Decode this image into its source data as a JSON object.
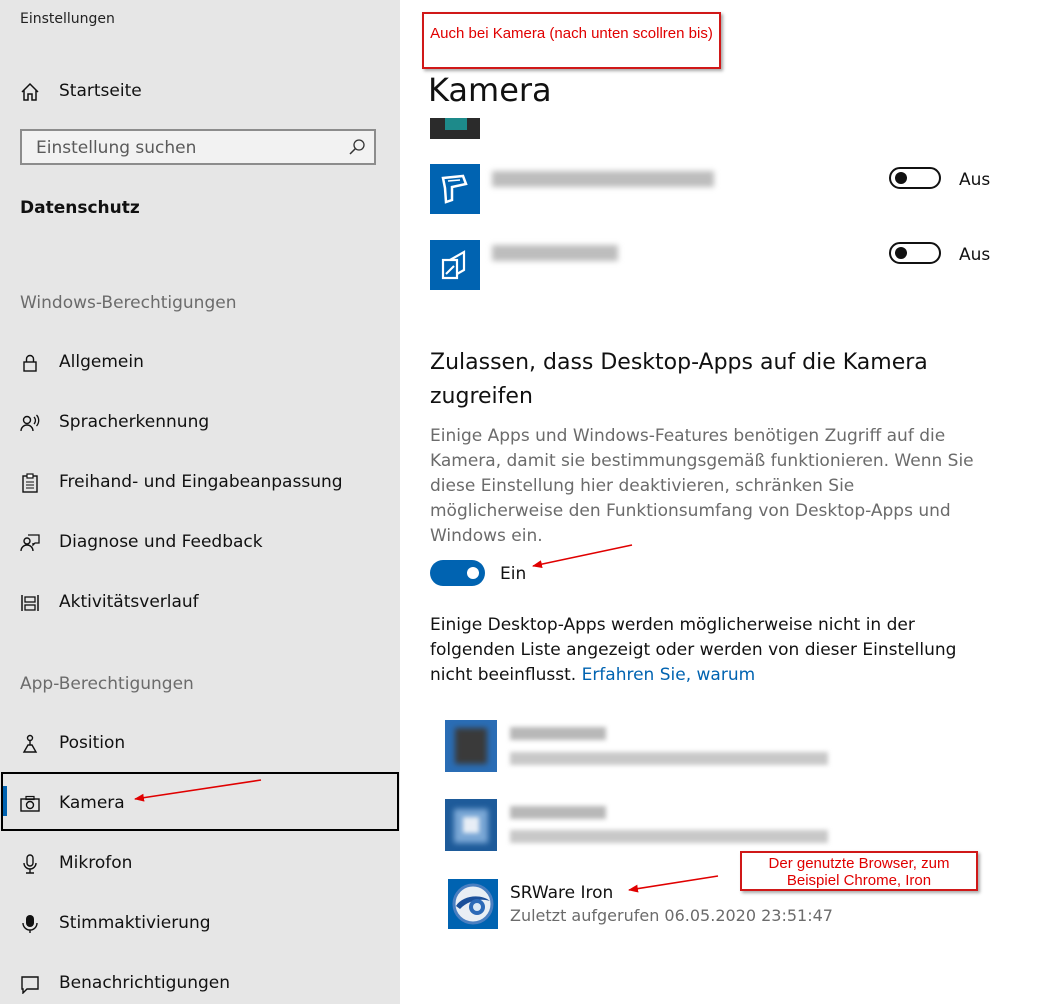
{
  "window": {
    "title": "Einstellungen"
  },
  "sidebar": {
    "home_label": "Startseite",
    "search_placeholder": "Einstellung suchen",
    "section_label": "Datenschutz",
    "group1_label": "Windows-Berechtigungen",
    "group1_items": [
      {
        "label": "Allgemein",
        "icon": "lock-icon"
      },
      {
        "label": "Spracherkennung",
        "icon": "speech-icon"
      },
      {
        "label": "Freihand- und Eingabeanpassung",
        "icon": "clipboard-icon"
      },
      {
        "label": "Diagnose und Feedback",
        "icon": "feedback-icon"
      },
      {
        "label": "Aktivitätsverlauf",
        "icon": "timeline-icon"
      }
    ],
    "group2_label": "App-Berechtigungen",
    "group2_items": [
      {
        "label": "Position",
        "icon": "position-icon"
      },
      {
        "label": "Kamera",
        "icon": "camera-icon",
        "selected": true
      },
      {
        "label": "Mikrofon",
        "icon": "microphone-icon"
      },
      {
        "label": "Stimmaktivierung",
        "icon": "voice-activation-icon"
      },
      {
        "label": "Benachrichtigungen",
        "icon": "notification-icon"
      }
    ]
  },
  "main": {
    "title": "Kamera",
    "store_apps": [
      {
        "toggle_label": "Aus",
        "state": "off"
      },
      {
        "toggle_label": "Aus",
        "state": "off"
      }
    ],
    "desktop_section": {
      "heading": "Zulassen, dass Desktop-Apps auf die Kamera zugreifen",
      "description": "Einige Apps und Windows-Features benötigen Zugriff auf die Kamera, damit sie bestimmungsgemäß funktionieren. Wenn Sie diese Einstellung hier deaktivieren, schränken Sie möglicherweise den Funktionsumfang von Desktop-Apps und Windows ein.",
      "toggle_label": "Ein",
      "note": "Einige Desktop-Apps werden möglicherweise nicht in der folgenden Liste angezeigt oder werden von dieser Einstellung nicht beeinflusst.",
      "link": "Erfahren Sie, warum"
    },
    "desktop_apps": [
      {
        "name": "SRWare Iron",
        "last_access": "Zuletzt aufgerufen 06.05.2020 23:51:47"
      }
    ]
  },
  "annotations": {
    "callout_top": "Auch bei Kamera (nach unten scollren bis)",
    "callout_browser": "Der genutzte Browser, zum Beispiel Chrome, Iron"
  },
  "colors": {
    "accent": "#0063b1",
    "callout_red": "#e00000",
    "sidebar_bg": "#e6e6e6"
  }
}
